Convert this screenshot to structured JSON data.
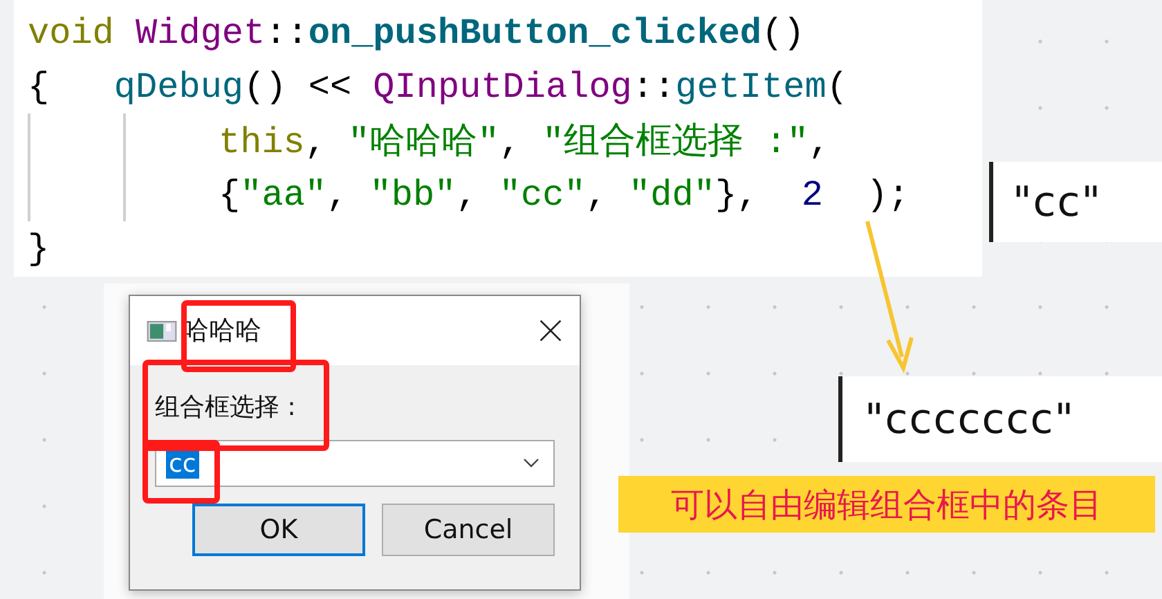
{
  "code": {
    "lines": [
      {
        "kind": "normal",
        "tokens": [
          {
            "kind": "keyword",
            "text": "void",
            "space_after": true
          },
          {
            "kind": "type",
            "text": "Widget"
          },
          {
            "kind": "plain",
            "text": "::"
          },
          {
            "kind": "function",
            "text": "on_pushButton_clicked"
          },
          {
            "kind": "plain",
            "text": "()"
          }
        ]
      },
      {
        "kind": "normal",
        "tokens": [
          {
            "kind": "plain",
            "text": "{   "
          },
          {
            "kind": "call",
            "text": "qDebug"
          },
          {
            "kind": "plain",
            "text": "() << "
          },
          {
            "kind": "type",
            "text": "QInputDialog"
          },
          {
            "kind": "plain",
            "text": "::"
          },
          {
            "kind": "call",
            "text": "getItem"
          },
          {
            "kind": "plain",
            "text": "("
          }
        ]
      },
      {
        "kind": "continuation",
        "tokens": [
          {
            "kind": "keyword",
            "text": "this"
          },
          {
            "kind": "plain",
            "text": ", "
          },
          {
            "kind": "string",
            "text": "\"哈哈哈\""
          },
          {
            "kind": "plain",
            "text": ", "
          },
          {
            "kind": "string",
            "text": "\"组合框选择 :\""
          },
          {
            "kind": "plain",
            "text": ","
          }
        ]
      },
      {
        "kind": "continuation",
        "tokens": [
          {
            "kind": "plain",
            "text": "{"
          },
          {
            "kind": "string",
            "text": "\"aa\""
          },
          {
            "kind": "plain",
            "text": ", "
          },
          {
            "kind": "string",
            "text": "\"bb\""
          },
          {
            "kind": "plain",
            "text": ", "
          },
          {
            "kind": "string",
            "text": "\"cc\""
          },
          {
            "kind": "plain",
            "text": ", "
          },
          {
            "kind": "string",
            "text": "\"dd\""
          },
          {
            "kind": "plain",
            "text": "},  "
          },
          {
            "kind": "number",
            "text": "2"
          },
          {
            "kind": "plain",
            "text": "  );"
          }
        ]
      },
      {
        "kind": "normal",
        "tokens": [
          {
            "kind": "plain",
            "text": "}"
          }
        ]
      }
    ]
  },
  "output_top": {
    "text": "\"cc\""
  },
  "dialog": {
    "title": "哈哈哈",
    "label": "组合框选择 :",
    "combo": {
      "value": "cc",
      "text_selected": true
    },
    "buttons": [
      {
        "label": "OK",
        "default": true
      },
      {
        "label": "Cancel",
        "default": false
      }
    ]
  },
  "output_bottom": {
    "text": "\"ccccccc\""
  },
  "note": "可以自由编辑组合框中的条目"
}
